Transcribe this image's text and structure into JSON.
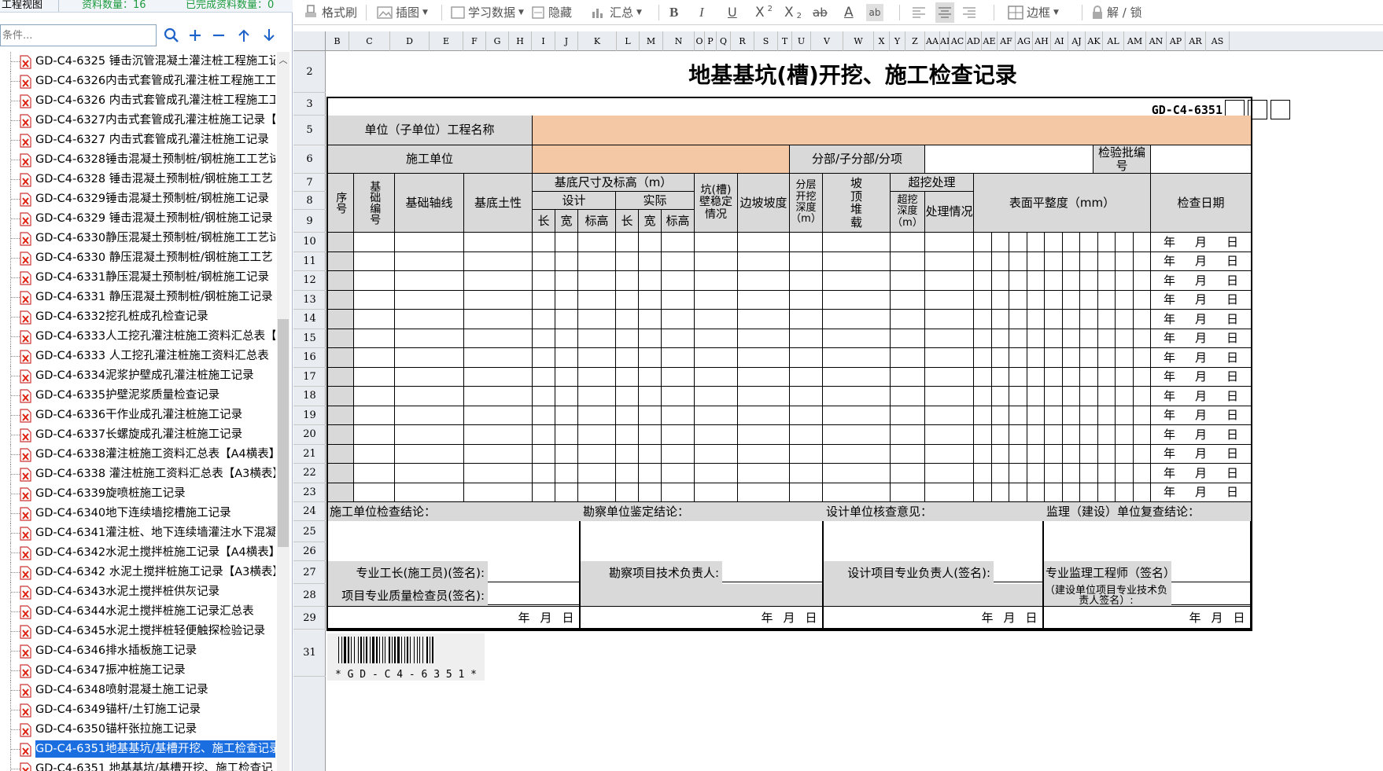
{
  "left_header": {
    "view_label": "工程视图",
    "count_label": "资料数量：16",
    "done_label": "已完成资料数量：0"
  },
  "search": {
    "placeholder": "条件..."
  },
  "tree_items": [
    "GD-C4-6325 锤击沉管混凝土灌注桩工程施工记",
    "GD-C4-6326内击式套管成孔灌注桩工程施工工",
    "GD-C4-6326 内击式套管成孔灌注桩工程施工工",
    "GD-C4-6327内击式套管成孔灌注桩施工记录【",
    "GD-C4-6327 内击式套管成孔灌注桩施工记录【",
    "GD-C4-6328锤击混凝土预制桩/钢桩施工工艺试",
    "GD-C4-6328 锤击混凝土预制桩/钢桩施工工艺",
    "GD-C4-6329锤击混凝土预制桩/钢桩施工记录【",
    "GD-C4-6329 锤击混凝土预制桩/钢桩施工记录",
    "GD-C4-6330静压混凝土预制桩/钢桩施工工艺试",
    "GD-C4-6330 静压混凝土预制桩/钢桩施工工艺",
    "GD-C4-6331静压混凝土预制桩/钢桩施工记录【",
    "GD-C4-6331 静压混凝土预制桩/钢桩施工记录",
    "GD-C4-6332挖孔桩成孔检查记录",
    "GD-C4-6333人工挖孔灌注桩施工资料汇总表【",
    "GD-C4-6333 人工挖孔灌注桩施工资料汇总表【",
    "GD-C4-6334泥浆护壁成孔灌注桩施工记录",
    "GD-C4-6335护壁泥浆质量检查记录",
    "GD-C4-6336干作业成孔灌注桩施工记录",
    "GD-C4-6337长螺旋成孔灌注桩施工记录",
    "GD-C4-6338灌注桩施工资料汇总表【A4横表】",
    "GD-C4-6338 灌注桩施工资料汇总表【A3横表】",
    "GD-C4-6339旋喷桩施工记录",
    "GD-C4-6340地下连续墙挖槽施工记录",
    "GD-C4-6341灌注桩、地下连续墙灌注水下混凝",
    "GD-C4-6342水泥土搅拌桩施工记录【A4横表】",
    "GD-C4-6342 水泥土搅拌桩施工记录【A3横表】",
    "GD-C4-6343水泥土搅拌桩供灰记录",
    "GD-C4-6344水泥土搅拌桩施工记录汇总表",
    "GD-C4-6345水泥土搅拌桩轻便触探检验记录",
    "GD-C4-6346排水插板施工记录",
    "GD-C4-6347振冲桩施工记录",
    "GD-C4-6348喷射混凝土施工记录",
    "GD-C4-6349锚杆/土钉施工记录",
    "GD-C4-6350锚杆张拉施工记录",
    "GD-C4-6351地基基坑/基槽开挖、施工检查记录",
    "GD-C4-6351 地基基坑/基槽开挖、施工检查记"
  ],
  "selected_index": 35,
  "toolbar": {
    "format_brush": "格式刷",
    "insert_image": "插图",
    "learn_data": "学习数据",
    "hide": "隐藏",
    "summary": "汇总",
    "bold": "B",
    "italic": "I",
    "underline": "U",
    "sup": "X",
    "sup_mark": "2",
    "sub": "X",
    "sub_mark": "2",
    "strike": "ab",
    "fontcolor": "A",
    "highlight": "ab",
    "border": "边框",
    "lock": "解 / 锁"
  },
  "columns": [
    "B",
    "C",
    "D",
    "E",
    "F",
    "G",
    "H",
    "I",
    "J",
    "K",
    "L",
    "M",
    "N",
    "O",
    "P",
    "Q",
    "R",
    "S",
    "T",
    "U",
    "V",
    "W",
    "X",
    "Y",
    "Z",
    "AA",
    "AE",
    "AC",
    "AD",
    "AE",
    "AF",
    "AG",
    "AH",
    "AI",
    "AJ",
    "AK",
    "AL",
    "AM",
    "AN",
    "AP",
    "AR",
    "AS"
  ],
  "rows": [
    "2",
    "3",
    "5",
    "6",
    "7",
    "8",
    "9",
    "10",
    "11",
    "12",
    "13",
    "14",
    "15",
    "16",
    "17",
    "18",
    "19",
    "20",
    "21",
    "22",
    "23",
    "24",
    "25",
    "26",
    "27",
    "28",
    "29",
    "31"
  ],
  "form": {
    "title": "地基基坑(槽)开挖、施工检查记录",
    "code": "GD-C4-6351",
    "unit_project": "单位（子单位）工程名称",
    "construction_unit": "施工单位",
    "sub_division": "分部/子分部/分项",
    "batch_no": "检验批编号",
    "seq": "序号",
    "base_no": "基础编号",
    "axis": "基础轴线",
    "soil": "基底土性",
    "dims": "基底尺寸及标高（m）",
    "design": "设计",
    "actual": "实际",
    "len": "长",
    "wid": "宽",
    "elev": "标高",
    "pit_stab": "坑(槽)壁稳定情况",
    "slope": "边坡坡度",
    "layer_depth": "分层开挖深度（m）",
    "top_load": "坡顶堆载",
    "overdig": "超挖处理",
    "overdig_depth": "超挖深度（m）",
    "handling": "处理情况",
    "flatness": "表面平整度（mm）",
    "check_date": "检查日期",
    "date_y": "年",
    "date_m": "月",
    "date_d": "日",
    "con_conclusion": "施工单位检查结论：",
    "survey_conclusion": "勘察单位鉴定结论：",
    "design_opinion": "设计单位核查意见：",
    "supervision_conclusion": "监理（建设）单位复查结论：",
    "foreman": "专业工长(施工员)(签名):",
    "qc": "项目专业质量检查员(签名):",
    "survey_lead": "勘察项目技术负责人:",
    "design_lead": "设计项目专业负责人(签名):",
    "supervisor": "专业监理工程师（签名）:",
    "owner_tech": "（建设单位项目专业技术负责人签名）:",
    "barcode_text": "* G D - C 4 - 6 3 5 1 *"
  }
}
